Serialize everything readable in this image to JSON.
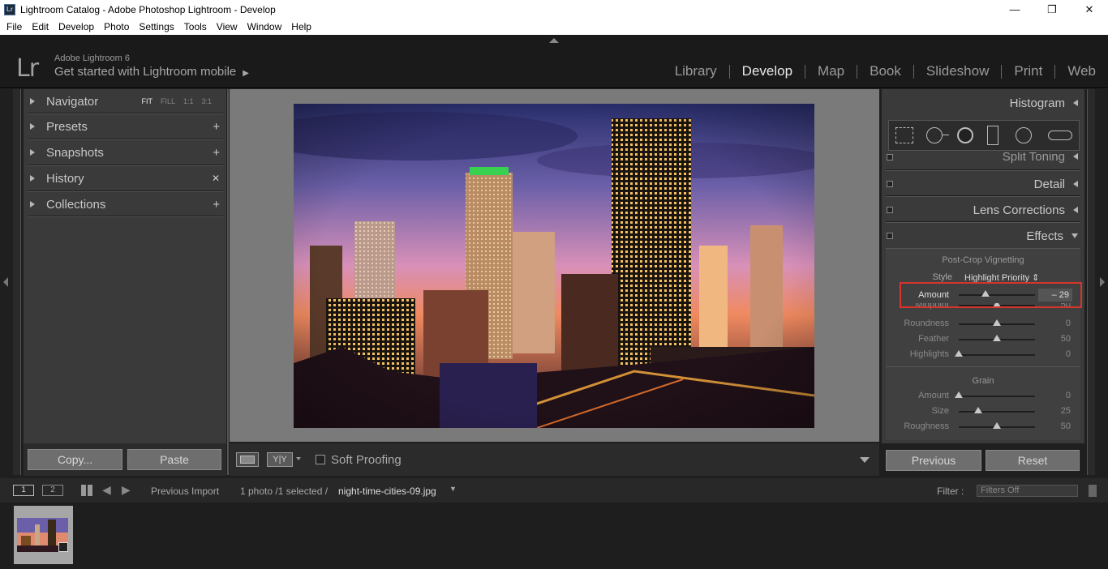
{
  "window": {
    "title": "Lightroom Catalog - Adobe Photoshop Lightroom - Develop",
    "app_icon": "Lr",
    "buttons": {
      "minimize": "—",
      "restore": "❐",
      "close": "✕"
    }
  },
  "menu": [
    "File",
    "Edit",
    "Develop",
    "Photo",
    "Settings",
    "Tools",
    "View",
    "Window",
    "Help"
  ],
  "identity": {
    "logo": "Lr",
    "version": "Adobe Lightroom 6",
    "mobile": "Get started with Lightroom mobile",
    "mobile_arrow": "▶"
  },
  "modules": [
    {
      "label": "Library",
      "active": false
    },
    {
      "label": "Develop",
      "active": true
    },
    {
      "label": "Map",
      "active": false
    },
    {
      "label": "Book",
      "active": false
    },
    {
      "label": "Slideshow",
      "active": false
    },
    {
      "label": "Print",
      "active": false
    },
    {
      "label": "Web",
      "active": false
    }
  ],
  "left_panel": {
    "navigator": {
      "label": "Navigator",
      "options": [
        "FIT",
        "FILL",
        "1:1",
        "3:1"
      ],
      "selected": "FIT"
    },
    "presets": {
      "label": "Presets",
      "action": "+"
    },
    "snapshots": {
      "label": "Snapshots",
      "action": "+"
    },
    "history": {
      "label": "History",
      "action": "✕"
    },
    "collections": {
      "label": "Collections",
      "action": "+"
    },
    "copy_label": "Copy...",
    "paste_label": "Paste"
  },
  "toolbar": {
    "compare_label": "Y|Y",
    "soft_proofing": "Soft Proofing",
    "soft_proofing_checked": false
  },
  "right_panel": {
    "histogram": "Histogram",
    "split_toning": "Split Toning",
    "detail": "Detail",
    "lens_corrections": "Lens Corrections",
    "effects": "Effects",
    "post_crop": {
      "title": "Post-Crop Vignetting",
      "style_label": "Style",
      "style_value": "Highlight Priority",
      "amount": {
        "label": "Amount",
        "value": "– 29",
        "level": -29,
        "min": -100,
        "max": 100
      },
      "midpoint": {
        "label": "Midpoint",
        "value": "50",
        "level": 50,
        "min": 0,
        "max": 100
      },
      "roundness": {
        "label": "Roundness",
        "value": "0",
        "level": 0,
        "min": -100,
        "max": 100
      },
      "feather": {
        "label": "Feather",
        "value": "50",
        "level": 50,
        "min": 0,
        "max": 100
      },
      "highlights": {
        "label": "Highlights",
        "value": "0",
        "level": 0,
        "min": 0,
        "max": 100
      }
    },
    "grain": {
      "title": "Grain",
      "amount": {
        "label": "Amount",
        "value": "0",
        "level": 0,
        "min": 0,
        "max": 100
      },
      "size": {
        "label": "Size",
        "value": "25",
        "level": 25,
        "min": 0,
        "max": 100
      },
      "roughness": {
        "label": "Roughness",
        "value": "50",
        "level": 50,
        "min": 0,
        "max": 100
      }
    },
    "previous_label": "Previous",
    "reset_label": "Reset"
  },
  "filmstrip_bar": {
    "view1": "1",
    "view2": "2",
    "source": "Previous Import",
    "count": "1 photo /1 selected /",
    "filename": "night-time-cities-09.jpg",
    "filter_label": "Filter :",
    "filter_value": "Filters Off"
  },
  "colors": {
    "highlight_box": "#d9342b",
    "panel_bg": "#3a3a3a",
    "canvas_bg": "#7a7a7a"
  }
}
